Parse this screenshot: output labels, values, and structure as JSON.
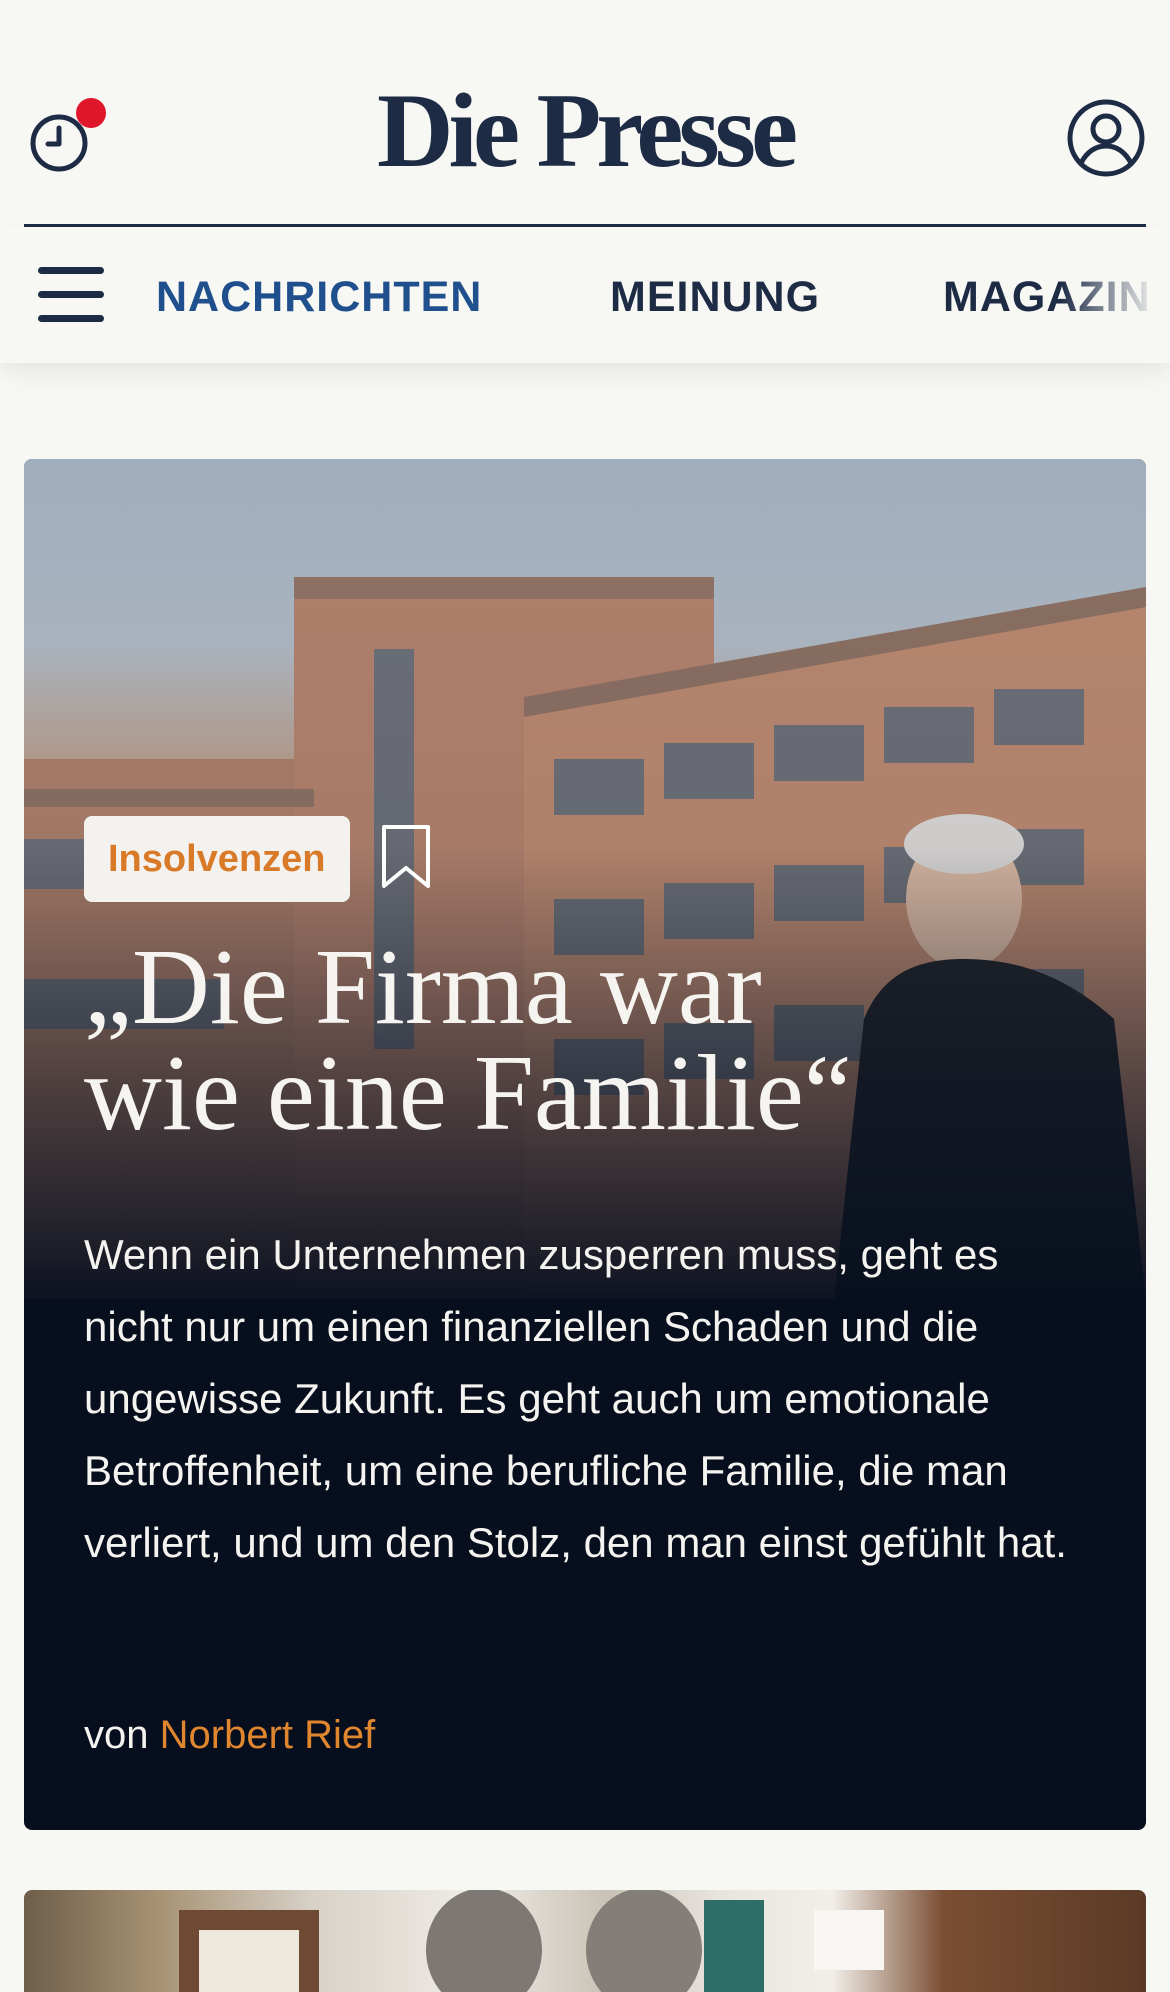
{
  "header": {
    "logo": "Die Presse",
    "icons": {
      "history": "clock-icon",
      "account": "user-icon"
    },
    "notification_color": "#e0162b"
  },
  "nav": {
    "menu_icon": "hamburger-menu-icon",
    "items": [
      {
        "label": "NACHRICHTEN",
        "active": true
      },
      {
        "label": "MEINUNG",
        "active": false
      },
      {
        "label": "MAGAZIN",
        "active": false
      }
    ]
  },
  "hero": {
    "tag": "Insolvenzen",
    "bookmark_icon": "bookmark-icon",
    "headline_line1": "„Die Firma war",
    "headline_line2": "wie eine Familie“",
    "lead": "Wenn ein Unternehmen zusperren muss, geht es nicht nur um einen finanziellen Schaden und die ungewisse Zukunft. Es geht auch um emotionale Betroffenheit, um eine berufliche Familie, die man verliert, und um den Stolz, den man einst gefühlt hat.",
    "byline_prefix": "von",
    "author": "Norbert Rief"
  },
  "colors": {
    "brand_navy": "#1d2b45",
    "nav_active": "#1f4f8c",
    "tag_text": "#d97a28",
    "author": "#e0862e",
    "card_bg": "#070f1e"
  }
}
